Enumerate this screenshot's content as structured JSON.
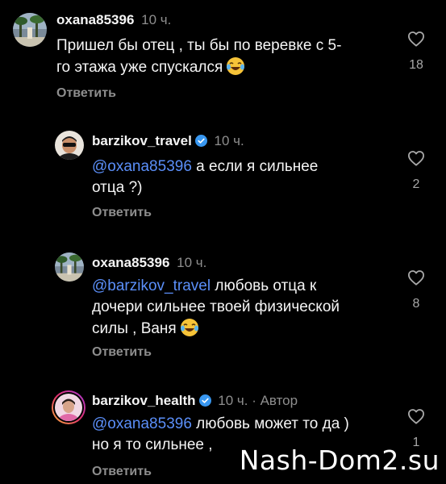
{
  "comments": [
    {
      "username": "oxana85396",
      "time": "10 ч.",
      "text_line1": "Пришел бы отец , ты бы по веревке с 5-",
      "text_line2": "го этажа уже спускался",
      "emoji": "laughing-emoji",
      "reply": "Ответить",
      "likes": "18"
    },
    {
      "username": "barzikov_travel",
      "verified": true,
      "time": "10 ч.",
      "mention": "@oxana85396",
      "text_line1": " а если я сильнее",
      "text_line2": "отца ?)",
      "reply": "Ответить",
      "likes": "2"
    },
    {
      "username": "oxana85396",
      "time": "10 ч.",
      "mention": "@barzikov_travel",
      "text_line1": " любовь отца к",
      "text_line2": "дочери сильнее твоей физической",
      "text_line3": "силы , Ваня",
      "emoji": "laughing-emoji",
      "reply": "Ответить",
      "likes": "8"
    },
    {
      "username": "barzikov_health",
      "verified": true,
      "time": "10 ч.",
      "author": "· Автор",
      "mention": "@oxana85396",
      "text_line1": " любовь может то да )",
      "text_line2": "но я то сильнее ,",
      "reply": "Ответить",
      "likes": "1"
    }
  ],
  "watermark": "Nash-Dom2.su",
  "colors": {
    "background": "#000000",
    "mention": "#5b8ff9",
    "muted": "#8e8e8e",
    "verified": "#3897f0"
  },
  "icons": [
    "heart-outline-icon",
    "verified-badge-icon",
    "laughing-emoji"
  ]
}
